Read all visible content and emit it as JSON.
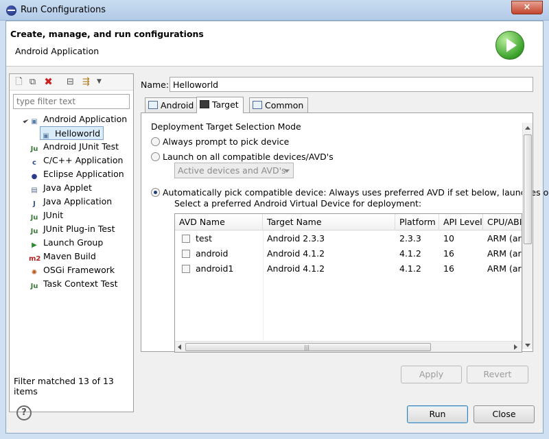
{
  "window": {
    "title": "Run Configurations",
    "close_label": "×"
  },
  "banner": {
    "title": "Create, manage, and run configurations",
    "subtitle": "Android Application"
  },
  "left": {
    "filter_placeholder": "type filter text",
    "toolbar": [
      "new-config",
      "duplicate",
      "delete",
      "collapse-all",
      "filter"
    ],
    "tree": [
      {
        "label": "Android Application",
        "icon": "android-app-icon",
        "glyph": "▣",
        "color": "#5b7fa6"
      },
      {
        "label": "Helloworld",
        "icon": "android-config-icon",
        "glyph": "▣",
        "color": "#5b7fa6",
        "selected": true
      },
      {
        "label": "Android JUnit Test",
        "icon": "junit-icon",
        "glyph": "Ju",
        "color": "#3b7a3b"
      },
      {
        "label": "C/C++ Application",
        "icon": "cpp-icon",
        "glyph": "c",
        "color": "#2b4b8a"
      },
      {
        "label": "Eclipse Application",
        "icon": "eclipse-icon",
        "glyph": "●",
        "color": "#2d3a8a"
      },
      {
        "label": "Java Applet",
        "icon": "applet-icon",
        "glyph": "▤",
        "color": "#5a6e8a"
      },
      {
        "label": "Java Application",
        "icon": "java-app-icon",
        "glyph": "J",
        "color": "#3a5a8a"
      },
      {
        "label": "JUnit",
        "icon": "junit-icon",
        "glyph": "Ju",
        "color": "#3b7a3b"
      },
      {
        "label": "JUnit Plug-in Test",
        "icon": "junit-plugin-icon",
        "glyph": "Ju",
        "color": "#3b7a3b"
      },
      {
        "label": "Launch Group",
        "icon": "launch-group-icon",
        "glyph": "▶",
        "color": "#2f8a2f"
      },
      {
        "label": "Maven Build",
        "icon": "maven-icon",
        "glyph": "m2",
        "color": "#b02020"
      },
      {
        "label": "OSGi Framework",
        "icon": "osgi-icon",
        "glyph": "✺",
        "color": "#b85a1a"
      },
      {
        "label": "Task Context Test",
        "icon": "task-context-icon",
        "glyph": "Ju",
        "color": "#3b7a3b"
      }
    ],
    "filter_status": "Filter matched 13 of 13 items"
  },
  "right": {
    "name_label": "Name:",
    "name_value": "Helloworld",
    "tabs": [
      {
        "label": "Android",
        "active": false
      },
      {
        "label": "Target",
        "active": true
      },
      {
        "label": "Common",
        "active": false
      }
    ],
    "group_title": "Deployment Target Selection Mode",
    "radio_prompt": "Always prompt to pick device",
    "radio_launch_all": "Launch on all compatible devices/AVD's",
    "device_combo": "Active devices and AVD's",
    "radio_auto": "Automatically pick compatible device: Always uses preferred AVD if set below, launches on",
    "avd_prompt": "Select a preferred Android Virtual Device for deployment:",
    "avd_columns": [
      "AVD Name",
      "Target Name",
      "Platform",
      "API Level",
      "CPU/ABI"
    ],
    "avd_rows": [
      {
        "name": "test",
        "target": "Android 2.3.3",
        "platform": "2.3.3",
        "api": "10",
        "cpu": "ARM (ar"
      },
      {
        "name": "android",
        "target": "Android 4.1.2",
        "platform": "4.1.2",
        "api": "16",
        "cpu": "ARM (ar"
      },
      {
        "name": "android1",
        "target": "Android 4.1.2",
        "platform": "4.1.2",
        "api": "16",
        "cpu": "ARM (ar"
      }
    ],
    "apply_label": "Apply",
    "revert_label": "Revert"
  },
  "footer": {
    "help_label": "?",
    "run_label": "Run",
    "close_label": "Close"
  }
}
